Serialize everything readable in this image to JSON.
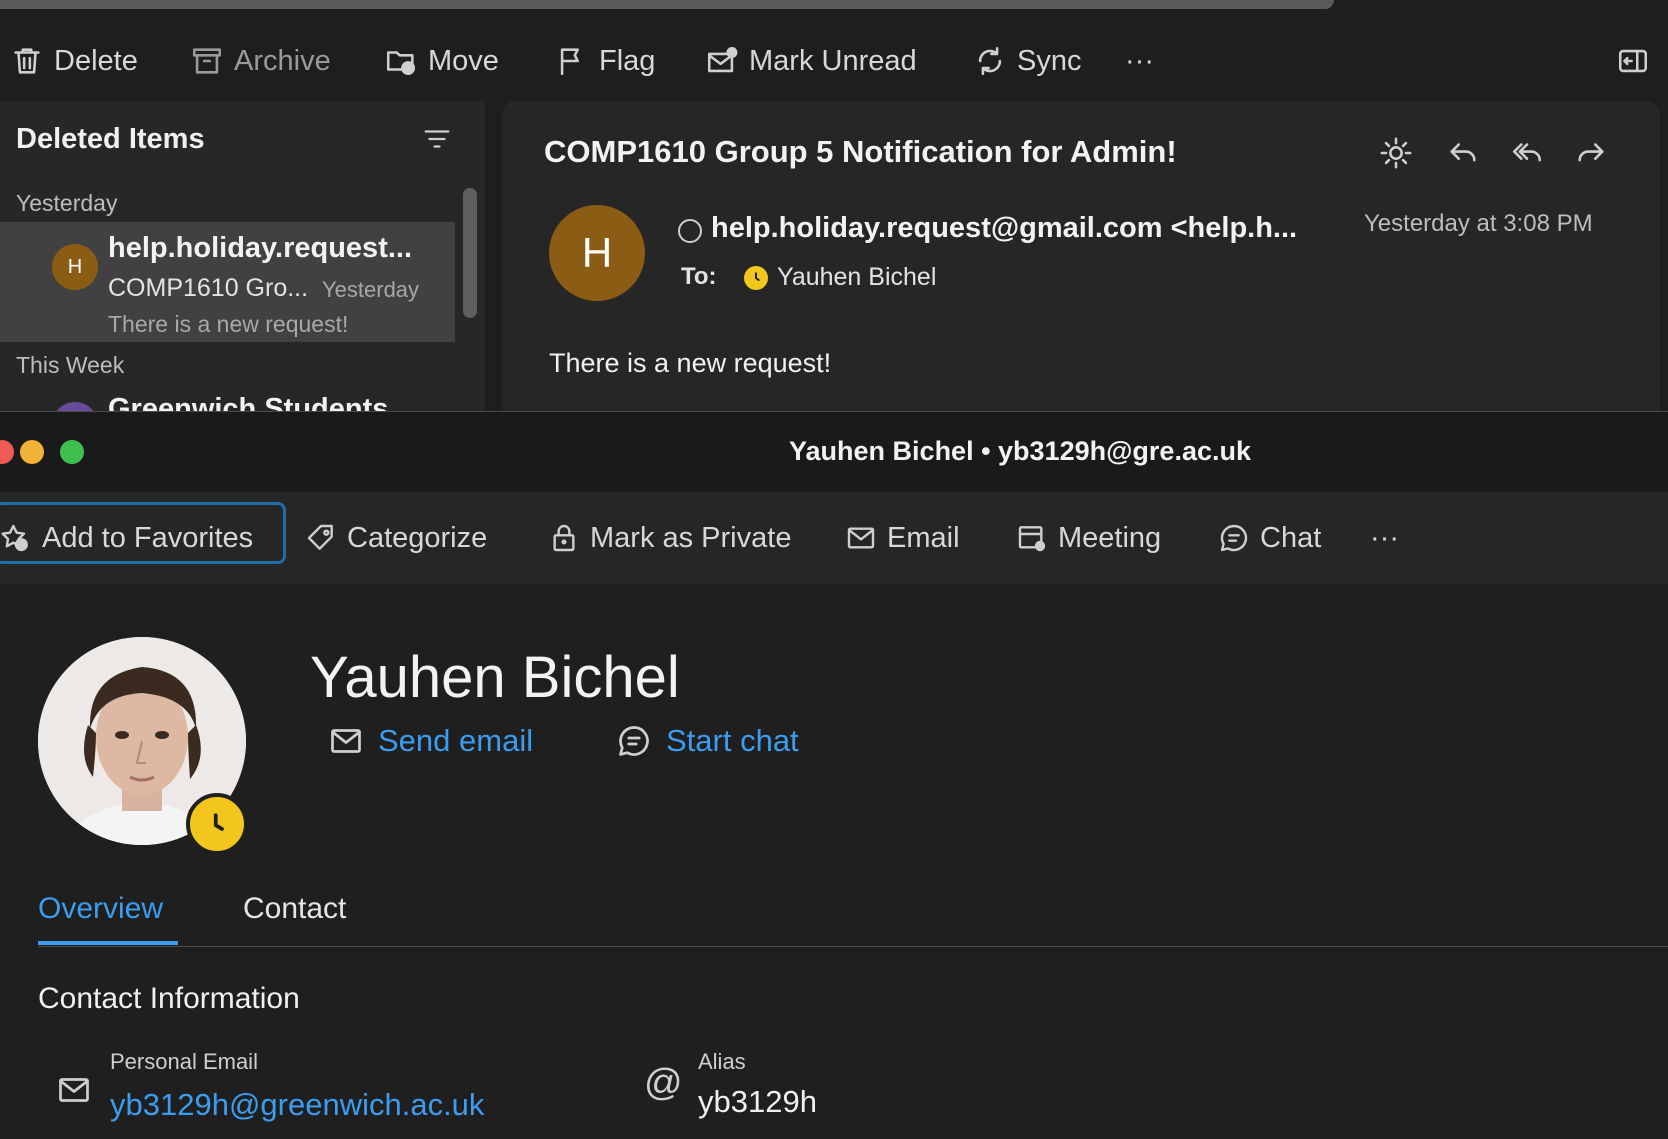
{
  "mail": {
    "toolbar": {
      "delete": "Delete",
      "archive": "Archive",
      "move": "Move",
      "flag": "Flag",
      "mark_unread": "Mark Unread",
      "sync": "Sync",
      "more": "···"
    },
    "list": {
      "title": "Deleted Items",
      "group_yesterday": "Yesterday",
      "group_this_week": "This Week",
      "selected_item": {
        "avatar_initial": "H",
        "sender": "help.holiday.request...",
        "subject": "COMP1610 Gro...",
        "date": "Yesterday",
        "preview": "There is a new request!"
      },
      "next_item_sender": "Greenwich Students"
    },
    "message": {
      "subject": "COMP1610 Group 5 Notification for Admin!",
      "avatar_initial": "H",
      "from": "help.holiday.request@gmail.com <help.h...",
      "to_label": "To:",
      "to_name": "Yauhen Bichel",
      "time": "Yesterday at 3:08 PM",
      "body": "There is a new request!"
    }
  },
  "contact": {
    "window_title": "Yauhen Bichel • yb3129h@gre.ac.uk",
    "toolbar": {
      "add_favorites": "Add to Favorites",
      "categorize": "Categorize",
      "mark_private": "Mark as Private",
      "email": "Email",
      "meeting": "Meeting",
      "chat": "Chat",
      "more": "···"
    },
    "name": "Yauhen Bichel",
    "send_email": "Send email",
    "start_chat": "Start chat",
    "tabs": {
      "overview": "Overview",
      "contact": "Contact"
    },
    "section_title": "Contact Information",
    "personal_email_label": "Personal Email",
    "personal_email": "yb3129h@greenwich.ac.uk",
    "alias_label": "Alias",
    "alias": "yb3129h"
  },
  "colors": {
    "accent_link": "#3b9cf0",
    "avatar_brown": "#8a5c14",
    "status_yellow": "#f2c61d",
    "focus_ring": "#1e6fa8"
  }
}
